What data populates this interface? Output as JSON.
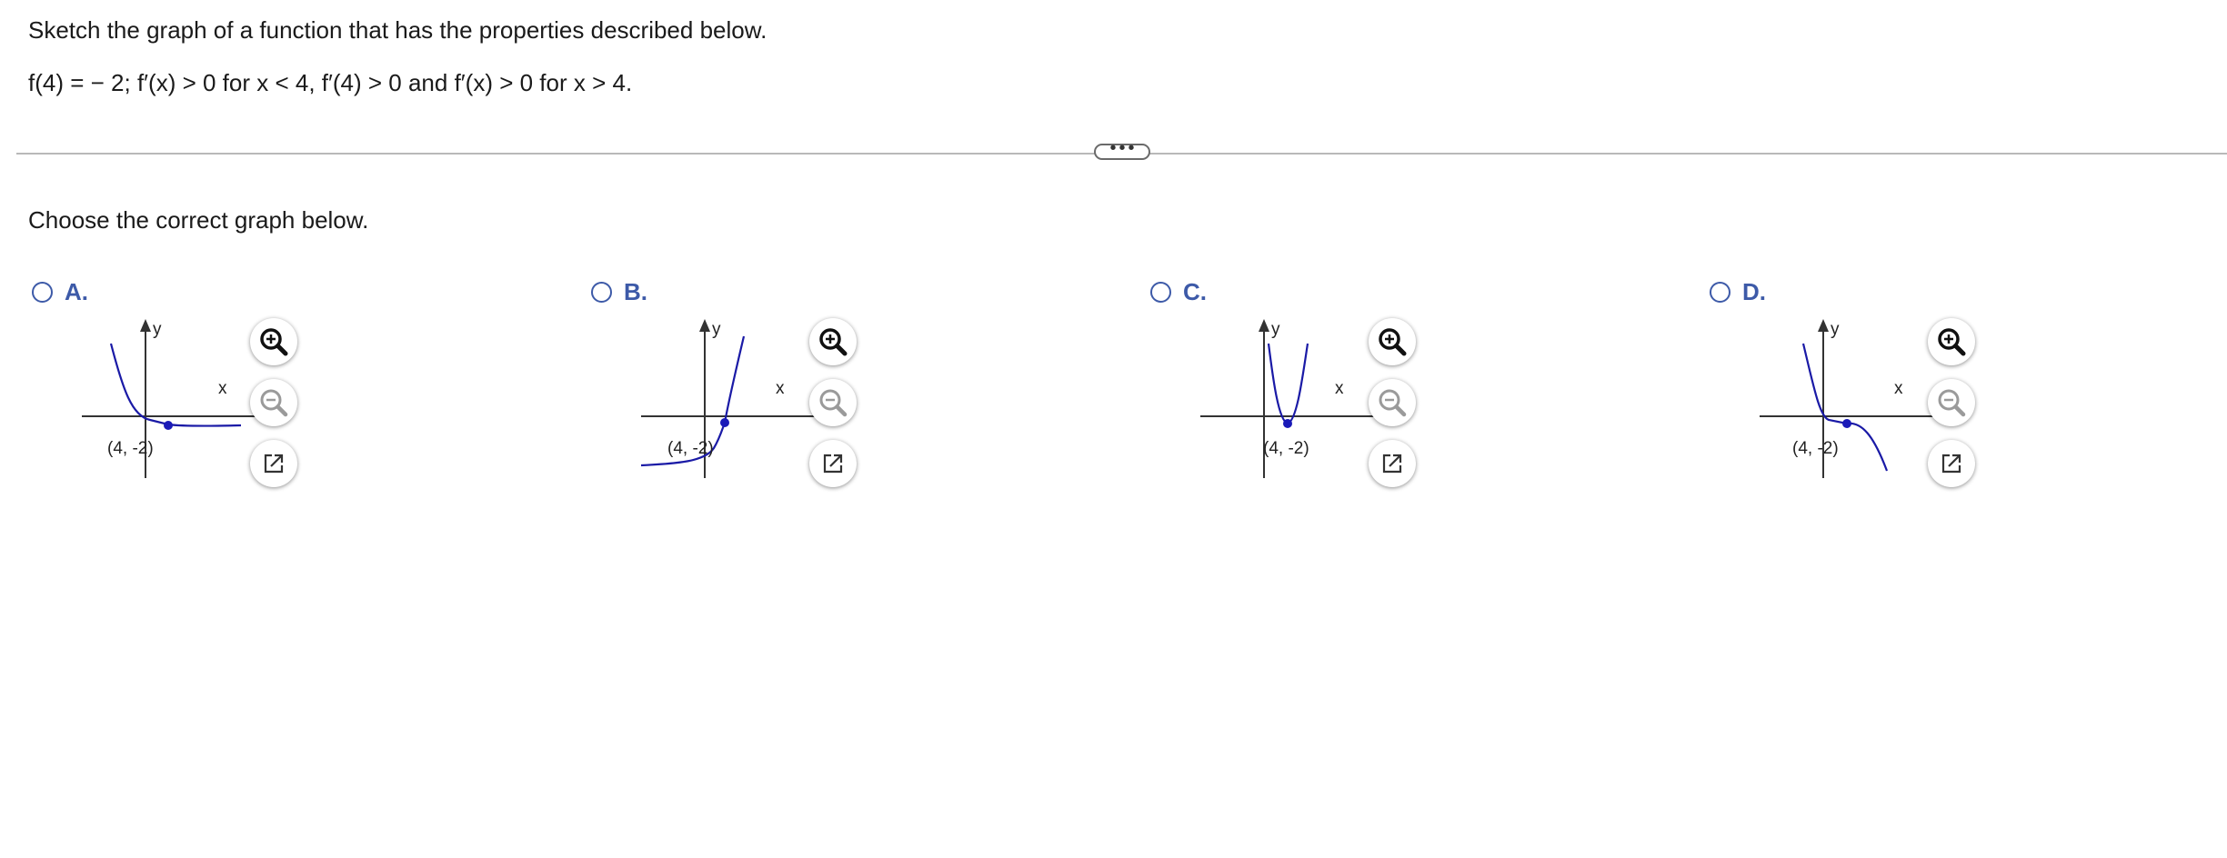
{
  "question": {
    "line1": "Sketch the graph of a function that has the properties described below.",
    "line2": "f(4) = − 2; f′(x) > 0 for x < 4, f′(4) > 0 and f′(x) > 0 for x > 4."
  },
  "more_button_label": "•••",
  "prompt": "Choose the correct graph below.",
  "colors": {
    "accent": "#3d5aa8",
    "curve": "#1a1aa6",
    "point": "#1a1ab8",
    "axis": "#333333"
  },
  "options": [
    {
      "letter": "A.",
      "axis_y_label": "y",
      "axis_x_label": "x",
      "point_label": "(4, -2)",
      "tool_icons": [
        "zoom-in-icon",
        "zoom-out-icon",
        "popout-icon"
      ]
    },
    {
      "letter": "B.",
      "axis_y_label": "y",
      "axis_x_label": "x",
      "point_label": "(4, -2)",
      "tool_icons": [
        "zoom-in-icon",
        "zoom-out-icon",
        "popout-icon"
      ]
    },
    {
      "letter": "C.",
      "axis_y_label": "y",
      "axis_x_label": "x",
      "point_label": "(4, -2)",
      "tool_icons": [
        "zoom-in-icon",
        "zoom-out-icon",
        "popout-icon"
      ]
    },
    {
      "letter": "D.",
      "axis_y_label": "y",
      "axis_x_label": "x",
      "point_label": "(4, -2)",
      "tool_icons": [
        "zoom-in-icon",
        "zoom-out-icon",
        "popout-icon"
      ]
    }
  ]
}
